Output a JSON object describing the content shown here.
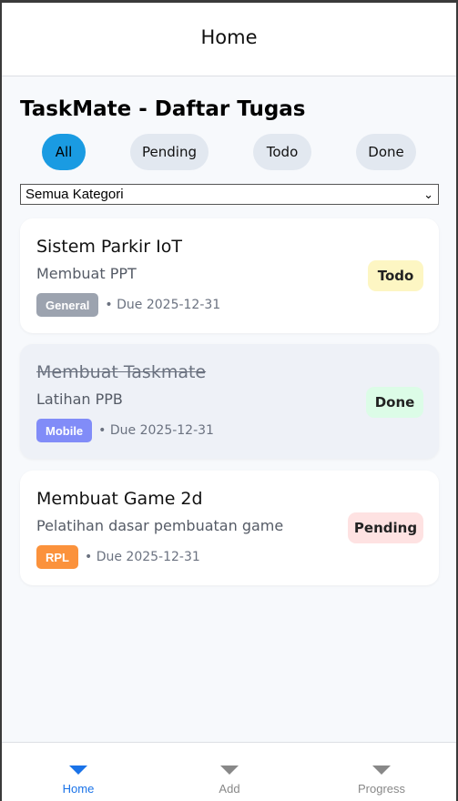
{
  "header": {
    "title": "Home"
  },
  "page": {
    "heading": "TaskMate - Daftar Tugas"
  },
  "filters": {
    "chips": [
      {
        "label": "All",
        "active": true
      },
      {
        "label": "Pending",
        "active": false
      },
      {
        "label": "Todo",
        "active": false
      },
      {
        "label": "Done",
        "active": false
      }
    ]
  },
  "category_select": {
    "selected": "Semua Kategori"
  },
  "tasks": [
    {
      "title": "Sistem Parkir IoT",
      "description": "Membuat PPT",
      "category": "General",
      "category_color": "#9ca3af",
      "due": "• Due 2025-12-31",
      "status": "Todo",
      "status_bg": "#fdf6c3",
      "done": false
    },
    {
      "title": "Membuat Taskmate",
      "description": "Latihan PPB",
      "category": "Mobile",
      "category_color": "#818cf8",
      "due": "• Due 2025-12-31",
      "status": "Done",
      "status_bg": "#dcfce7",
      "done": true
    },
    {
      "title": "Membuat Game 2d",
      "description": "Pelatihan dasar pembuatan game",
      "category": "RPL",
      "category_color": "#fb923c",
      "due": "• Due 2025-12-31",
      "status": "Pending",
      "status_bg": "#fee2e2",
      "done": false
    }
  ],
  "bottom_nav": {
    "items": [
      {
        "label": "Home",
        "icon": "triangle-down-icon",
        "active": true
      },
      {
        "label": "Add",
        "icon": "triangle-down-icon",
        "active": false
      },
      {
        "label": "Progress",
        "icon": "triangle-down-icon",
        "active": false
      }
    ]
  },
  "colors": {
    "accent": "#1a9be2",
    "nav_active": "#1a73e8"
  }
}
